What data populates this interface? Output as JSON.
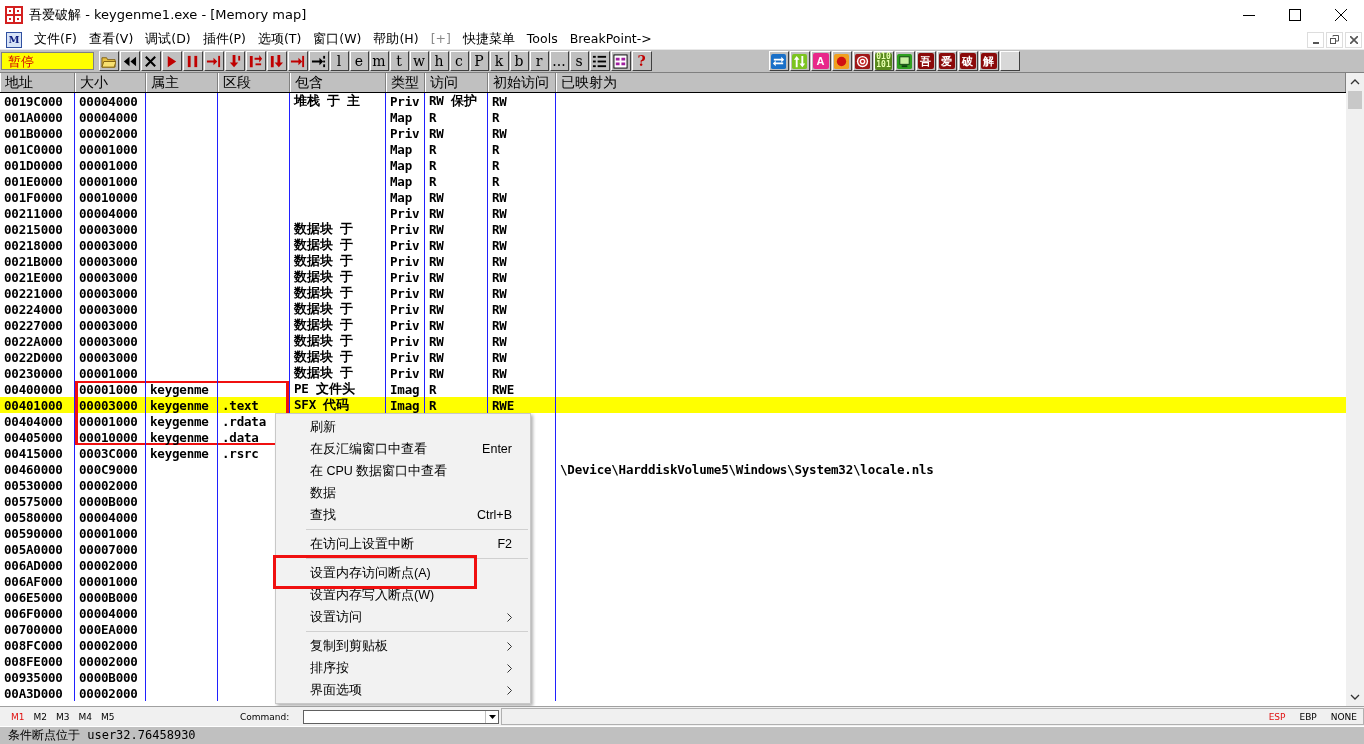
{
  "window": {
    "title": "吾爱破解 - keygenme1.exe - [Memory map]"
  },
  "menu_bar": {
    "logo": "M",
    "items": [
      {
        "label": "文件(F)",
        "disabled": false
      },
      {
        "label": "查看(V)",
        "disabled": false
      },
      {
        "label": "调试(D)",
        "disabled": false
      },
      {
        "label": "插件(P)",
        "disabled": false
      },
      {
        "label": "选项(T)",
        "disabled": false
      },
      {
        "label": "窗口(W)",
        "disabled": false
      },
      {
        "label": "帮助(H)",
        "disabled": false
      },
      {
        "label": "[+]",
        "disabled": true
      },
      {
        "label": "快捷菜单",
        "disabled": false
      },
      {
        "label": "Tools",
        "disabled": false
      },
      {
        "label": "BreakPoint->",
        "disabled": false
      }
    ]
  },
  "toolbar": {
    "status": "暂停",
    "buttons": [
      {
        "kind": "open"
      },
      {
        "kind": "rewind"
      },
      {
        "kind": "close"
      },
      {
        "kind": "run"
      },
      {
        "kind": "pause"
      },
      {
        "kind": "step-into"
      },
      {
        "kind": "step-over"
      },
      {
        "kind": "trace-into"
      },
      {
        "kind": "trace-over"
      },
      {
        "kind": "return"
      },
      {
        "kind": "goto"
      },
      {
        "kind": "letter",
        "label": "l"
      },
      {
        "kind": "letter",
        "label": "e"
      },
      {
        "kind": "letter",
        "label": "m"
      },
      {
        "kind": "letter",
        "label": "t"
      },
      {
        "kind": "letter",
        "label": "w"
      },
      {
        "kind": "letter",
        "label": "h"
      },
      {
        "kind": "letter",
        "label": "c"
      },
      {
        "kind": "letter",
        "label": "P"
      },
      {
        "kind": "letter",
        "label": "k"
      },
      {
        "kind": "letter",
        "label": "b"
      },
      {
        "kind": "letter",
        "label": "r"
      },
      {
        "kind": "letter",
        "label": "..."
      },
      {
        "kind": "letter",
        "label": "s"
      },
      {
        "kind": "list"
      },
      {
        "kind": "grid"
      },
      {
        "kind": "help",
        "label": "?"
      }
    ],
    "plugins": [
      {
        "kind": "swap"
      },
      {
        "kind": "updown"
      },
      {
        "kind": "tile",
        "label": "A",
        "color": "#e8288a"
      },
      {
        "kind": "record"
      },
      {
        "kind": "target"
      },
      {
        "kind": "tile",
        "label": "010 101",
        "color": "#5a8a1e"
      },
      {
        "kind": "screen"
      },
      {
        "kind": "tile",
        "label": "吾",
        "color": "#8b0a0a"
      },
      {
        "kind": "tile",
        "label": "爱",
        "color": "#8b0a0a"
      },
      {
        "kind": "tile",
        "label": "破",
        "color": "#8b0a0a"
      },
      {
        "kind": "tile",
        "label": "解",
        "color": "#8b0a0a"
      },
      {
        "kind": "blank"
      }
    ]
  },
  "table": {
    "columns": [
      "地址",
      "大小",
      "属主",
      "区段",
      "包含",
      "类型",
      "访问",
      "初始访问",
      "已映射为"
    ],
    "rows": [
      {
        "address": "0019C000",
        "size": "00004000",
        "contains": "堆栈 于 主",
        "type": "Priv",
        "access": "RW 保护",
        "initial_access": "RW",
        "selected": false,
        "outlined": false
      },
      {
        "address": "001A0000",
        "size": "00004000",
        "type": "Map",
        "access": "R",
        "initial_access": "R",
        "selected": false,
        "outlined": false
      },
      {
        "address": "001B0000",
        "size": "00002000",
        "type": "Priv",
        "access": "RW",
        "initial_access": "RW",
        "selected": false,
        "outlined": false
      },
      {
        "address": "001C0000",
        "size": "00001000",
        "type": "Map",
        "access": "R",
        "initial_access": "R",
        "selected": false,
        "outlined": false
      },
      {
        "address": "001D0000",
        "size": "00001000",
        "type": "Map",
        "access": "R",
        "initial_access": "R",
        "selected": false,
        "outlined": false
      },
      {
        "address": "001E0000",
        "size": "00001000",
        "type": "Map",
        "access": "R",
        "initial_access": "R",
        "selected": false,
        "outlined": false
      },
      {
        "address": "001F0000",
        "size": "00010000",
        "type": "Map",
        "access": "RW",
        "initial_access": "RW",
        "selected": false,
        "outlined": false
      },
      {
        "address": "00211000",
        "size": "00004000",
        "type": "Priv",
        "access": "RW",
        "initial_access": "RW",
        "selected": false,
        "outlined": false
      },
      {
        "address": "00215000",
        "size": "00003000",
        "contains": "数据块 于",
        "type": "Priv",
        "access": "RW",
        "initial_access": "RW",
        "selected": false,
        "outlined": false
      },
      {
        "address": "00218000",
        "size": "00003000",
        "contains": "数据块 于",
        "type": "Priv",
        "access": "RW",
        "initial_access": "RW",
        "selected": false,
        "outlined": false
      },
      {
        "address": "0021B000",
        "size": "00003000",
        "contains": "数据块 于",
        "type": "Priv",
        "access": "RW",
        "initial_access": "RW",
        "selected": false,
        "outlined": false
      },
      {
        "address": "0021E000",
        "size": "00003000",
        "contains": "数据块 于",
        "type": "Priv",
        "access": "RW",
        "initial_access": "RW",
        "selected": false,
        "outlined": false
      },
      {
        "address": "00221000",
        "size": "00003000",
        "contains": "数据块 于",
        "type": "Priv",
        "access": "RW",
        "initial_access": "RW",
        "selected": false,
        "outlined": false
      },
      {
        "address": "00224000",
        "size": "00003000",
        "contains": "数据块 于",
        "type": "Priv",
        "access": "RW",
        "initial_access": "RW",
        "selected": false,
        "outlined": false
      },
      {
        "address": "00227000",
        "size": "00003000",
        "contains": "数据块 于",
        "type": "Priv",
        "access": "RW",
        "initial_access": "RW",
        "selected": false,
        "outlined": false
      },
      {
        "address": "0022A000",
        "size": "00003000",
        "contains": "数据块 于",
        "type": "Priv",
        "access": "RW",
        "initial_access": "RW",
        "selected": false,
        "outlined": false
      },
      {
        "address": "0022D000",
        "size": "00003000",
        "contains": "数据块 于",
        "type": "Priv",
        "access": "RW",
        "initial_access": "RW",
        "selected": false,
        "outlined": false
      },
      {
        "address": "00230000",
        "size": "00001000",
        "contains": "数据块 于",
        "type": "Priv",
        "access": "RW",
        "initial_access": "RW",
        "selected": false,
        "outlined": false
      },
      {
        "address": "00400000",
        "size": "00001000",
        "owner": "keygenme",
        "contains": "PE 文件头",
        "type": "Imag",
        "access": "R",
        "initial_access": "RWE",
        "selected": false,
        "outlined": true
      },
      {
        "address": "00401000",
        "size": "00003000",
        "owner": "keygenme",
        "section": ".text",
        "contains": "SFX 代码",
        "type": "Imag",
        "access": "R",
        "initial_access": "RWE",
        "selected": true,
        "outlined": true
      },
      {
        "address": "00404000",
        "size": "00001000",
        "owner": "keygenme",
        "section": ".rdata",
        "selected": false,
        "outlined": true
      },
      {
        "address": "00405000",
        "size": "00010000",
        "owner": "keygenme",
        "section": ".data",
        "selected": false,
        "outlined": true
      },
      {
        "address": "00415000",
        "size": "0003C000",
        "owner": "keygenme",
        "section": ".rsrc",
        "selected": false,
        "outlined": false
      },
      {
        "address": "00460000",
        "size": "000C9000",
        "mapped_as": "\\Device\\HarddiskVolume5\\Windows\\System32\\locale.nls",
        "selected": false,
        "outlined": false
      },
      {
        "address": "00530000",
        "size": "00002000",
        "selected": false,
        "outlined": false
      },
      {
        "address": "00575000",
        "size": "0000B000",
        "selected": false,
        "outlined": false
      },
      {
        "address": "00580000",
        "size": "00004000",
        "selected": false,
        "outlined": false
      },
      {
        "address": "00590000",
        "size": "00001000",
        "selected": false,
        "outlined": false
      },
      {
        "address": "005A0000",
        "size": "00007000",
        "selected": false,
        "outlined": false
      },
      {
        "address": "006AD000",
        "size": "00002000",
        "selected": false,
        "outlined": false
      },
      {
        "address": "006AF000",
        "size": "00001000",
        "selected": false,
        "outlined": false
      },
      {
        "address": "006E5000",
        "size": "0000B000",
        "selected": false,
        "outlined": false
      },
      {
        "address": "006F0000",
        "size": "00004000",
        "selected": false,
        "outlined": false
      },
      {
        "address": "00700000",
        "size": "000EA000",
        "selected": false,
        "outlined": false
      },
      {
        "address": "008FC000",
        "size": "00002000",
        "selected": false,
        "outlined": false
      },
      {
        "address": "008FE000",
        "size": "00002000",
        "selected": false,
        "outlined": false
      },
      {
        "address": "00935000",
        "size": "0000B000",
        "selected": false,
        "outlined": false
      },
      {
        "address": "00A3D000",
        "size": "00002000",
        "selected": false,
        "outlined": false
      }
    ]
  },
  "context_menu": {
    "items": [
      {
        "kind": "item",
        "label": "刷新",
        "submenu": false,
        "outlined": false
      },
      {
        "kind": "item",
        "label": "在反汇编窗口中查看",
        "shortcut": "Enter",
        "submenu": false,
        "outlined": false
      },
      {
        "kind": "item",
        "label": "在 CPU 数据窗口中查看",
        "submenu": false,
        "outlined": false
      },
      {
        "kind": "item",
        "label": "数据",
        "submenu": false,
        "outlined": false
      },
      {
        "kind": "item",
        "label": "查找",
        "shortcut": "Ctrl+B",
        "submenu": false,
        "outlined": false
      },
      {
        "kind": "separator"
      },
      {
        "kind": "item",
        "label": "在访问上设置中断",
        "shortcut": "F2",
        "submenu": false,
        "outlined": false
      },
      {
        "kind": "separator"
      },
      {
        "kind": "item",
        "label": "设置内存访问断点(A)",
        "submenu": false,
        "outlined": true
      },
      {
        "kind": "item",
        "label": "设置内存写入断点(W)",
        "submenu": false,
        "outlined": false
      },
      {
        "kind": "item",
        "label": "设置访问",
        "submenu": true,
        "outlined": false
      },
      {
        "kind": "separator"
      },
      {
        "kind": "item",
        "label": "复制到剪贴板",
        "submenu": true,
        "outlined": false
      },
      {
        "kind": "item",
        "label": "排序按",
        "submenu": true,
        "outlined": false
      },
      {
        "kind": "item",
        "label": "界面选项",
        "submenu": true,
        "outlined": false
      }
    ]
  },
  "bottom_bar": {
    "markers": [
      {
        "label": "M1",
        "selected": true
      },
      {
        "label": "M2",
        "selected": false
      },
      {
        "label": "M3",
        "selected": false
      },
      {
        "label": "M4",
        "selected": false
      },
      {
        "label": "M5",
        "selected": false
      }
    ],
    "command_label": "Command:",
    "registers": [
      {
        "label": "ESP",
        "selected": true
      },
      {
        "label": "EBP",
        "selected": false
      },
      {
        "label": "NONE",
        "selected": false
      }
    ]
  },
  "status_bar": {
    "text": "条件断点位于 user32.76458930"
  }
}
